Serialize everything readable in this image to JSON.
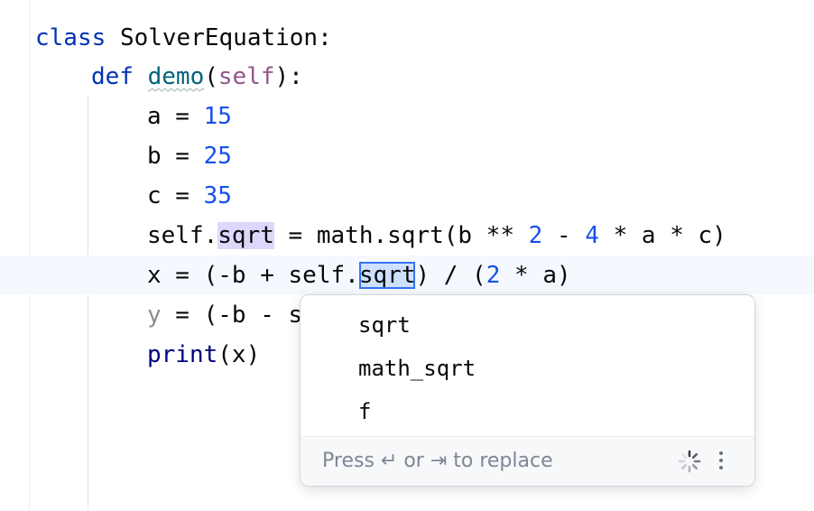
{
  "code": {
    "line1": {
      "keyword": "class",
      "name": "SolverEquation",
      "colon": ":"
    },
    "line2": {
      "keyword": "def",
      "name": "demo",
      "open": "(",
      "self": "self",
      "close": "):"
    },
    "line3": {
      "var": "a",
      "eq": " = ",
      "val": "15"
    },
    "line4": {
      "var": "b",
      "eq": " = ",
      "val": "25"
    },
    "line5": {
      "var": "c",
      "eq": " = ",
      "val": "35"
    },
    "line6": {
      "p1": "self.",
      "attr": "sqrt",
      "p2": " = math.sqrt(b ** ",
      "n1": "2",
      "p3": " - ",
      "n2": "4",
      "p4": " * a * c)"
    },
    "line7": {
      "p1": "x = (-b + self.",
      "attr": "sqrt",
      "p2": ") / (",
      "n1": "2",
      "p3": " * a)"
    },
    "line8": {
      "dim": "y",
      "rest": " = (-b - s"
    },
    "line9": {
      "builtin": "print",
      "rest": "(x)"
    }
  },
  "popup": {
    "items": [
      "sqrt",
      "math_sqrt",
      "f"
    ],
    "hint": "Press ↵ or ⇥ to replace",
    "spinner_icon": "loading-spinner-icon",
    "menu_icon": "vertical-dots-icon"
  }
}
